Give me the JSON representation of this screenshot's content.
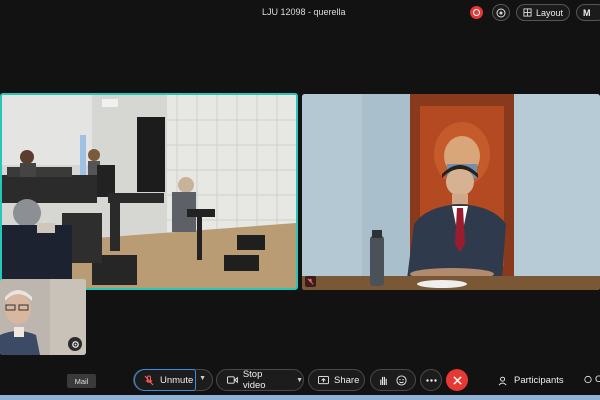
{
  "header": {
    "meeting_title": "LJU 12098 - querella",
    "layout_label": "Layout",
    "more_label": "M"
  },
  "controls": {
    "unmute_label": "Unmute",
    "stop_video_label": "Stop video",
    "share_label": "Share",
    "participants_label": "Participants",
    "extra_label": "C"
  },
  "tooltip": {
    "mail": "Mail"
  },
  "colors": {
    "active_speaker_border": "#27c7b8",
    "leave_button": "#e53935",
    "unmute_focus": "#3a8ee6",
    "background": "#121212"
  }
}
